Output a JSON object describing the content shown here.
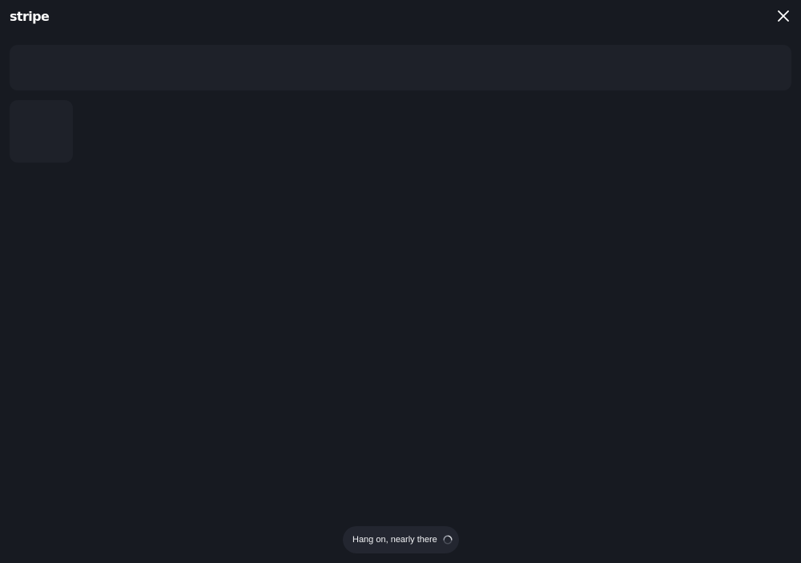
{
  "header": {
    "logo_text": "stripe",
    "close_icon": "close-icon"
  },
  "status": {
    "message": "Hang on, nearly there",
    "spinner_icon": "loading-spinner-icon"
  },
  "colors": {
    "background": "#171a21",
    "skeleton": "#1e2129",
    "toast_background": "#232630",
    "text": "#ffffff"
  }
}
